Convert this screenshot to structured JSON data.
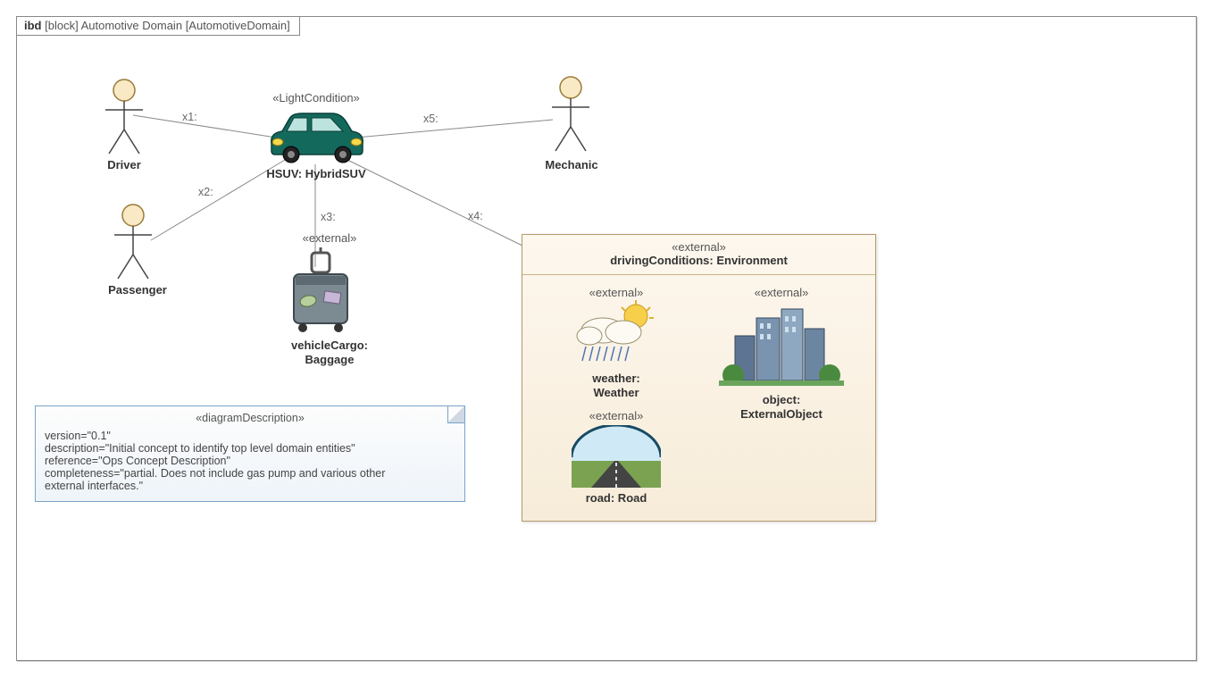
{
  "frame": {
    "kind": "ibd",
    "bracket": "[block]",
    "title": "Automotive Domain",
    "alias": "[AutomotiveDomain]"
  },
  "actors": {
    "driver": "Driver",
    "passenger": "Passenger",
    "mechanic": "Mechanic"
  },
  "hsuv": {
    "stereotype": "«LightCondition»",
    "label": "HSUV: HybridSUV"
  },
  "baggage": {
    "stereotype": "«external»",
    "label1": "vehicleCargo:",
    "label2": "Baggage"
  },
  "env": {
    "stereotype": "«external»",
    "title": "drivingConditions: Environment",
    "weather": {
      "stereotype": "«external»",
      "label1": "weather:",
      "label2": "Weather"
    },
    "road": {
      "stereotype": "«external»",
      "label": "road: Road"
    },
    "object": {
      "stereotype": "«external»",
      "label1": "object:",
      "label2": "ExternalObject"
    }
  },
  "connectors": {
    "x1": "x1:",
    "x2": "x2:",
    "x3": "x3:",
    "x4": "x4:",
    "x5": "x5:"
  },
  "note": {
    "stereotype": "«diagramDescription»",
    "lines": {
      "l1": "version=\"0.1\"",
      "l2": "description=\"Initial concept to identify top level domain entities\"",
      "l3": "reference=\"Ops Concept Description\"",
      "l4": "completeness=\"partial. Does not include gas pump and various other",
      "l5": "external interfaces.\""
    }
  }
}
